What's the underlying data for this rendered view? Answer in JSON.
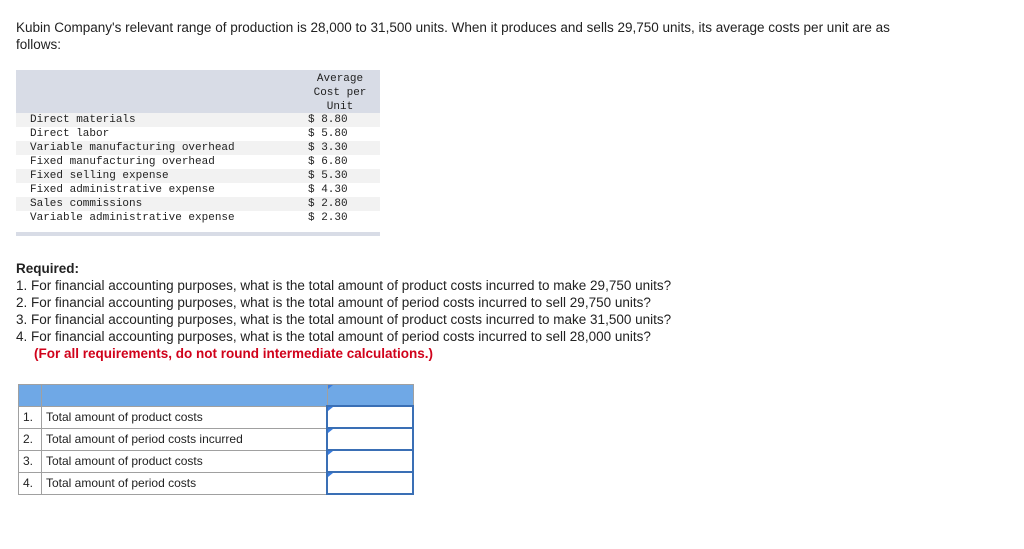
{
  "intro": "Kubin Company's relevant range of production is 28,000 to 31,500 units. When it produces and sells 29,750 units, its average costs per unit are as follows:",
  "cost_table": {
    "header": "Average\nCost per\nUnit",
    "rows": [
      {
        "label": "Direct materials",
        "value": "$ 8.80"
      },
      {
        "label": "Direct labor",
        "value": "$ 5.80"
      },
      {
        "label": "Variable manufacturing overhead",
        "value": "$ 3.30"
      },
      {
        "label": "Fixed manufacturing overhead",
        "value": "$ 6.80"
      },
      {
        "label": "Fixed selling expense",
        "value": "$ 5.30"
      },
      {
        "label": "Fixed administrative expense",
        "value": "$ 4.30"
      },
      {
        "label": "Sales commissions",
        "value": "$ 2.80"
      },
      {
        "label": "Variable administrative expense",
        "value": "$ 2.30"
      }
    ]
  },
  "required": {
    "title": "Required:",
    "items": [
      "1. For financial accounting purposes, what is the total amount of product costs incurred to make 29,750 units?",
      "2. For financial accounting purposes, what is the total amount of period costs incurred to sell 29,750 units?",
      "3. For financial accounting purposes, what is the total amount of product costs incurred to make 31,500 units?",
      "4. For financial accounting purposes, what is the total amount of period costs incurred to sell 28,000 units?"
    ],
    "note": "(For all requirements, do not round intermediate calculations.)"
  },
  "answer_table": {
    "rows": [
      {
        "num": "1.",
        "label": "Total amount of product costs",
        "value": ""
      },
      {
        "num": "2.",
        "label": "Total amount of period costs incurred",
        "value": ""
      },
      {
        "num": "3.",
        "label": "Total amount of product costs",
        "value": ""
      },
      {
        "num": "4.",
        "label": "Total amount of period costs",
        "value": ""
      }
    ]
  }
}
